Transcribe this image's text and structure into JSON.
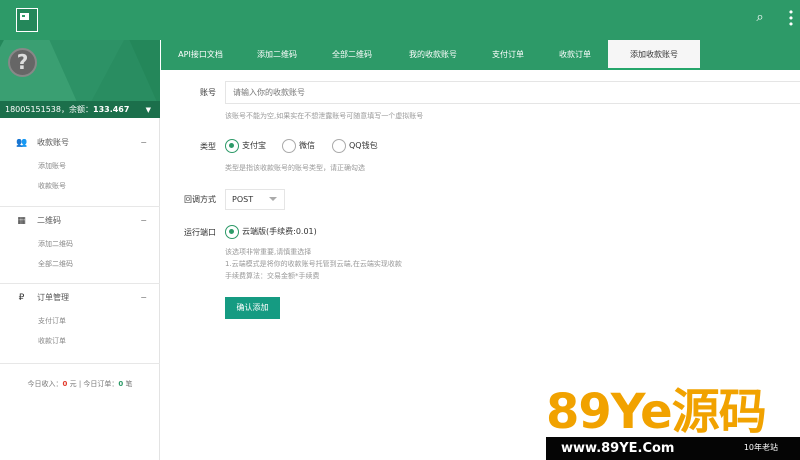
{
  "topbar": {
    "search_icon": "search-icon",
    "more_icon": "more-vertical-icon"
  },
  "sidebar": {
    "account": "18005151538，余额：",
    "balance": "133.467",
    "groups": [
      {
        "title": "收款账号",
        "icon": "users-icon",
        "items": [
          "添加账号",
          "收款账号"
        ]
      },
      {
        "title": "二维码",
        "icon": "qrcode-icon",
        "items": [
          "添加二维码",
          "全部二维码"
        ]
      },
      {
        "title": "订单管理",
        "icon": "payment-icon",
        "items": [
          "支付订单",
          "收款订单"
        ]
      }
    ],
    "stats": {
      "income_label": "今日收入：",
      "income": "0",
      "income_unit": "元",
      "separator": "|",
      "orders_label": "今日订单：",
      "orders": "0",
      "orders_unit": "笔"
    }
  },
  "tabs": [
    "API接口文档",
    "添加二维码",
    "全部二维码",
    "我的收款账号",
    "支付订单",
    "收款订单",
    "添加收款账号"
  ],
  "form": {
    "account_label": "账号",
    "account_placeholder": "请输入你的收款账号",
    "account_help": "该账号不能为空,如果实在不想泄露账号可随意填写一个虚拟账号",
    "type_label": "类型",
    "type_options": [
      "支付宝",
      "微信",
      "QQ钱包"
    ],
    "type_selected": "支付宝",
    "type_help": "类型是指该收款账号的账号类型，请正确勾选",
    "callback_label": "回调方式",
    "callback_value": "POST",
    "run_label": "运行端口",
    "run_option": "云端版(手续费:0.01)",
    "run_help": [
      "该选项非常重要,请慎重选择",
      "1.云端模式是将你的收款账号托管到云端,在云端实现收款",
      "手续费算法：交易金额*手续费"
    ],
    "submit_label": "确认添加"
  },
  "watermark": {
    "main": "89Ye源码",
    "site": "www.89YE.Com",
    "note": "10年老站"
  },
  "colors": {
    "primary": "#2d9a68",
    "dark_green": "#1b6f4b",
    "button": "#159b82",
    "accent_red": "#e23c2d",
    "watermark": "#f1a200"
  }
}
